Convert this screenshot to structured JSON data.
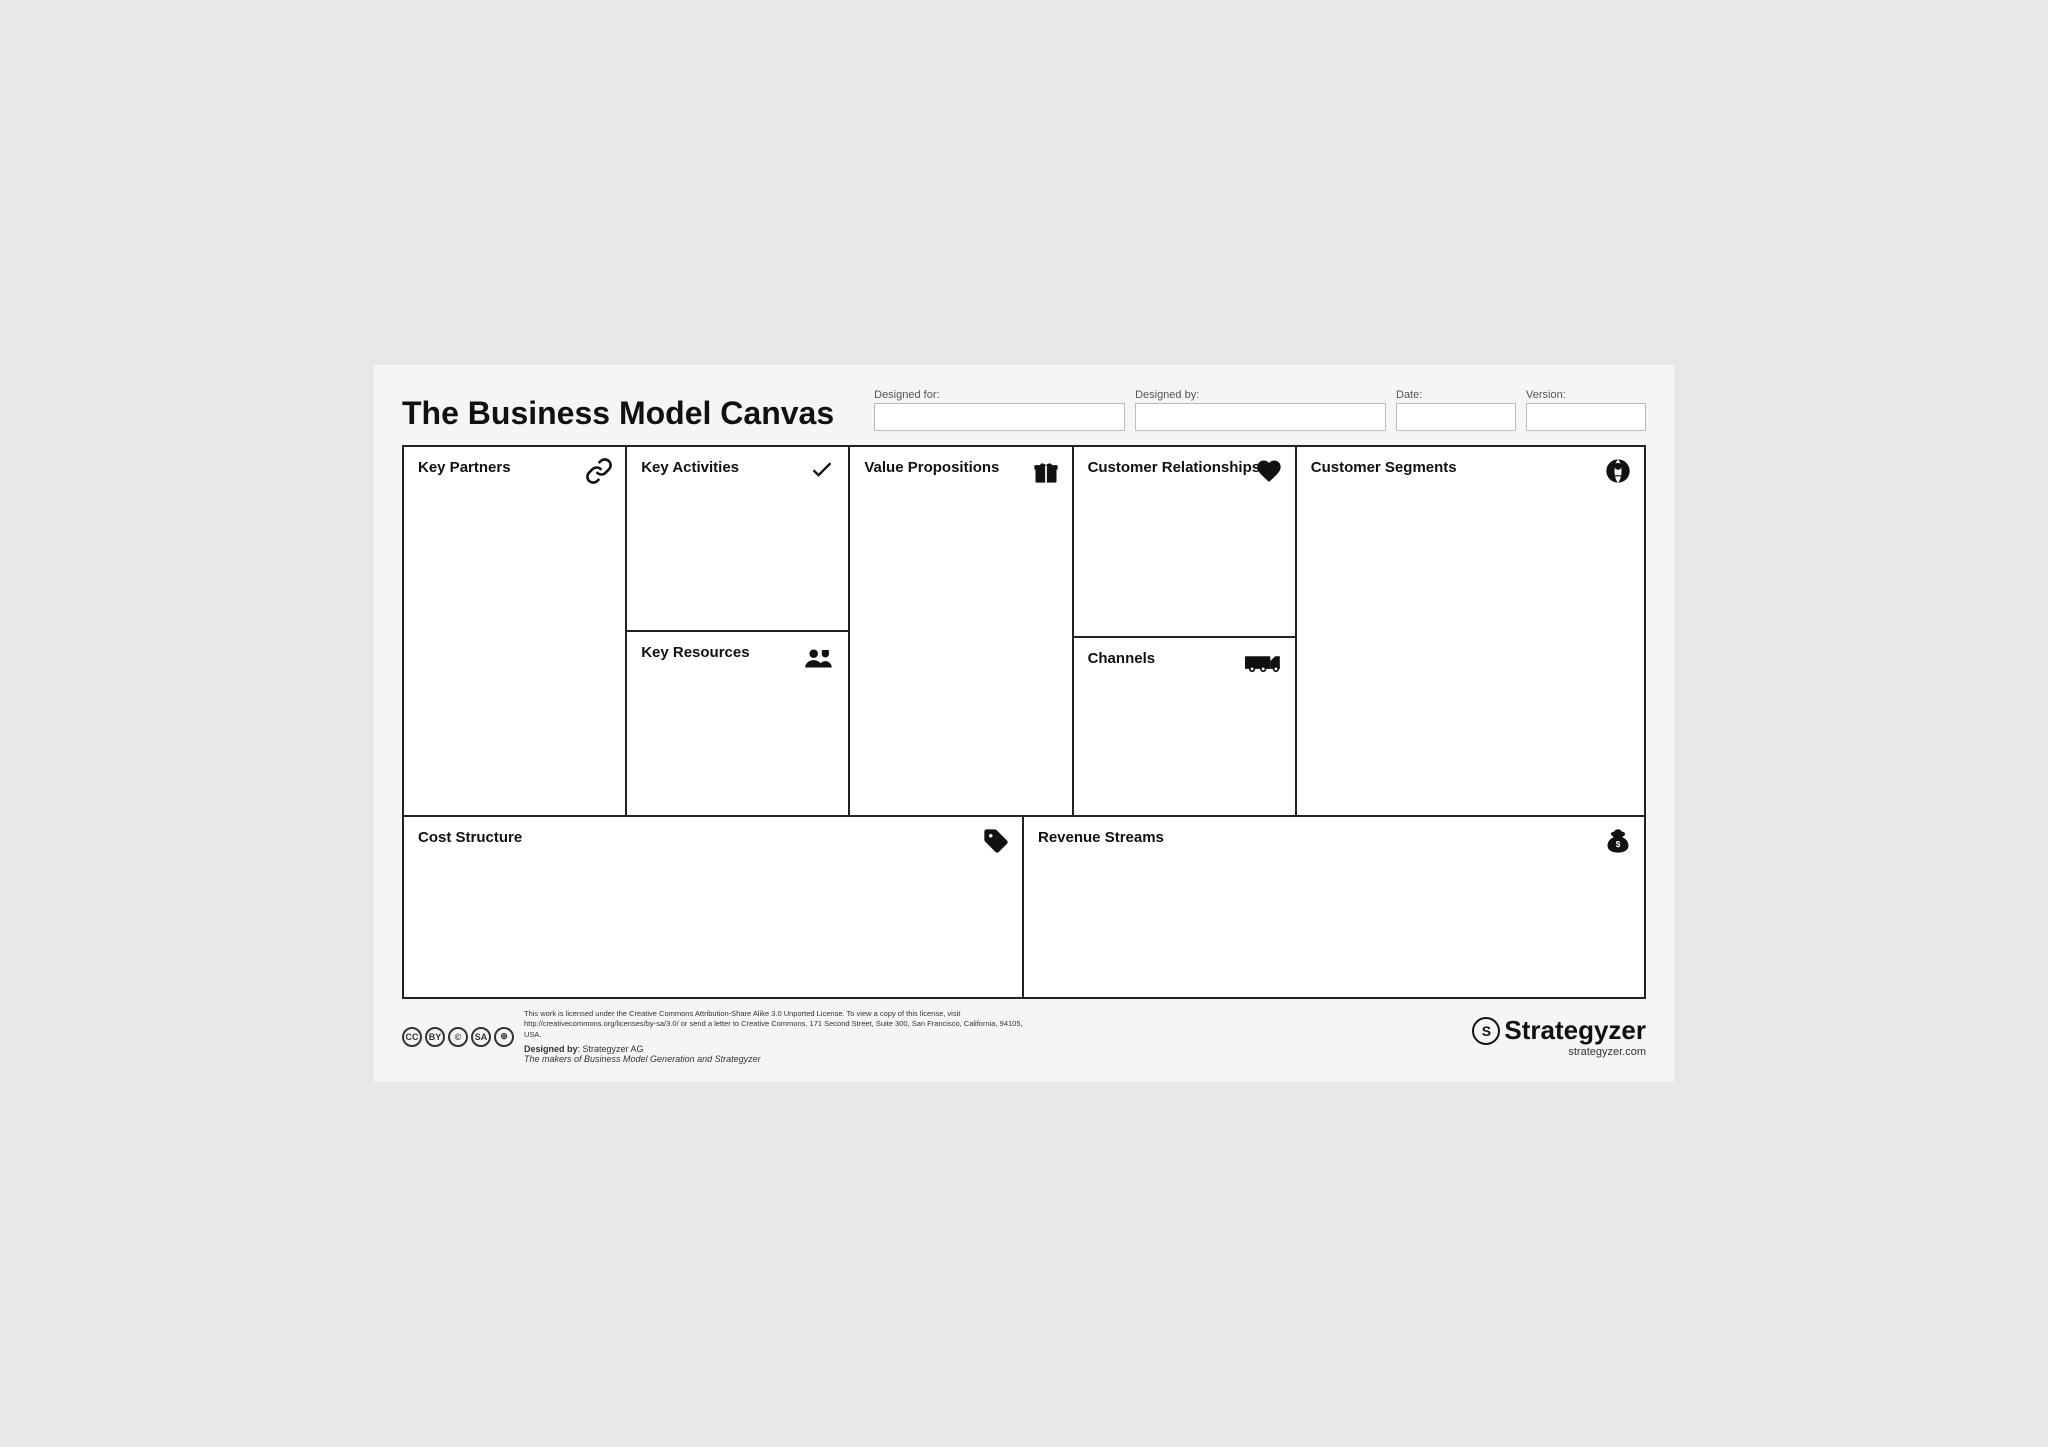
{
  "page": {
    "title": "The Business Model Canvas",
    "header_fields": [
      {
        "label": "Designed for:",
        "value": ""
      },
      {
        "label": "Designed by:",
        "value": ""
      },
      {
        "label": "Date:",
        "value": ""
      },
      {
        "label": "Version:",
        "value": ""
      }
    ]
  },
  "cells": {
    "key_partners": {
      "label": "Key Partners",
      "icon": "link"
    },
    "key_activities": {
      "label": "Key Activities",
      "icon": "checkmark"
    },
    "key_resources": {
      "label": "Key Resources",
      "icon": "people-tools"
    },
    "value_propositions": {
      "label": "Value Propositions",
      "icon": "gift"
    },
    "customer_relationships": {
      "label": "Customer Relationships",
      "icon": "heart"
    },
    "channels": {
      "label": "Channels",
      "icon": "truck"
    },
    "customer_segments": {
      "label": "Customer Segments",
      "icon": "person-circle"
    },
    "cost_structure": {
      "label": "Cost Structure",
      "icon": "tag"
    },
    "revenue_streams": {
      "label": "Revenue Streams",
      "icon": "money-bag"
    }
  },
  "footer": {
    "designed_by_label": "Designed by",
    "designed_by_value": "Strategyzer AG",
    "tagline": "The makers of Business Model Generation and Strategyzer",
    "license_text": "This work is licensed under the Creative Commons Attribution-Share Alike 3.0 Unported License. To view a copy of this license, visit\nhttp://creativecommons.org/licenses/by-sa/3.0/ or send a letter to Creative Commons, 171 Second Street, Suite 300, San Francisco, California, 94105, USA.",
    "brand": "Strategyzer",
    "brand_url": "strategyzer.com"
  }
}
